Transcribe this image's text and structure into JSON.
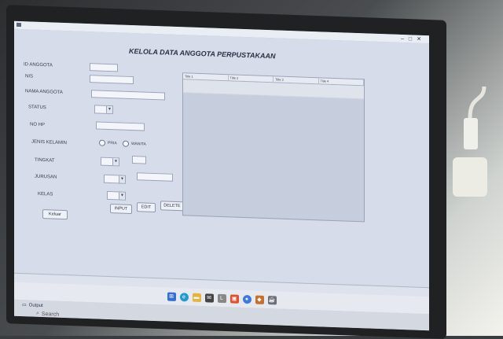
{
  "form": {
    "title": "KELOLA DATA ANGGOTA PERPUSTAKAAN",
    "labels": {
      "id_anggota": "ID ANGGOTA",
      "nis": "NIS",
      "nama_anggota": "NAMA ANGGOTA",
      "status": "STATUS",
      "no_hp": "NO HP",
      "jenis_kelamin": "JENIS KELAMIN",
      "tingkat": "TINGKAT",
      "jurusan": "JURUSAN",
      "kelas": "KELAS"
    },
    "radio": {
      "pria": "PRIA",
      "wanita": "WANITA"
    },
    "buttons": {
      "keluar": "Keluar",
      "input": "INPUT",
      "edit": "EDIT",
      "delete": "DELETE"
    }
  },
  "table": {
    "columns": [
      "Title 1",
      "Title 2",
      "Title 3",
      "Title 4"
    ]
  },
  "bottom": {
    "output_tab": "Output",
    "search_placeholder": "Search"
  },
  "colors": {
    "window_bg": "#d6dcea",
    "taskbar": "#e6e9f0"
  },
  "icons": [
    "search-icon",
    "windows-start-icon",
    "edge-icon",
    "file-explorer-icon",
    "mail-icon"
  ]
}
